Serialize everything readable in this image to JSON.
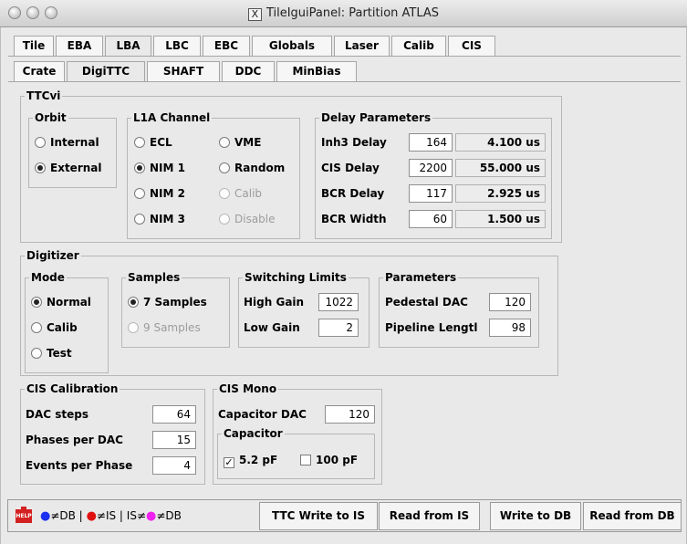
{
  "window": {
    "title": "TileIguiPanel: Partition ATLAS",
    "x_label": "X"
  },
  "tabs_main": [
    "Tile",
    "EBA",
    "LBA",
    "LBC",
    "EBC",
    "Globals",
    "Laser",
    "Calib",
    "CIS"
  ],
  "tabs_sub": [
    "Crate",
    "DigiTTC",
    "SHAFT",
    "DDC",
    "MinBias"
  ],
  "ttcvi": {
    "label": "TTCvi",
    "orbit": {
      "label": "Orbit",
      "internal": "Internal",
      "external": "External"
    },
    "l1a": {
      "label": "L1A Channel",
      "ecl": "ECL",
      "vme": "VME",
      "nim1": "NIM 1",
      "random": "Random",
      "nim2": "NIM 2",
      "calib": "Calib",
      "nim3": "NIM 3",
      "disable": "Disable"
    },
    "delay": {
      "label": "Delay Parameters",
      "rows": [
        {
          "label": "Inh3 Delay",
          "value": "164",
          "time": "4.100 us"
        },
        {
          "label": "CIS Delay",
          "value": "2200",
          "time": "55.000 us"
        },
        {
          "label": "BCR Delay",
          "value": "117",
          "time": "2.925 us"
        },
        {
          "label": "BCR Width",
          "value": "60",
          "time": "1.500 us"
        }
      ]
    }
  },
  "digitizer": {
    "label": "Digitizer",
    "mode": {
      "label": "Mode",
      "normal": "Normal",
      "calib": "Calib",
      "test": "Test"
    },
    "samples": {
      "label": "Samples",
      "s7": "7 Samples",
      "s9": "9 Samples"
    },
    "switching": {
      "label": "Switching Limits",
      "high_label": "High Gain",
      "high_value": "1022",
      "low_label": "Low Gain",
      "low_value": "2"
    },
    "params": {
      "label": "Parameters",
      "ped_label": "Pedestal DAC",
      "ped_value": "120",
      "pipe_label": "Pipeline Lengtl",
      "pipe_value": "98"
    }
  },
  "cis_calib": {
    "label": "CIS Calibration",
    "dac_label": "DAC steps",
    "dac_value": "64",
    "phases_label": "Phases per DAC",
    "phases_value": "15",
    "events_label": "Events per Phase",
    "events_value": "4"
  },
  "cis_mono": {
    "label": "CIS Mono",
    "capdac_label": "Capacitor DAC",
    "capdac_value": "120",
    "capacitor_label": "Capacitor",
    "c52": "5.2 pF",
    "c100": "100 pF"
  },
  "bottom": {
    "help": "HELP",
    "legend": {
      "db1": "≠DB |",
      "is1": "≠IS | IS≠",
      "db2": "≠DB"
    },
    "ttc_write": "TTC Write to IS",
    "read_is": "Read from IS",
    "write_db": "Write to DB",
    "read_db": "Read from DB"
  }
}
